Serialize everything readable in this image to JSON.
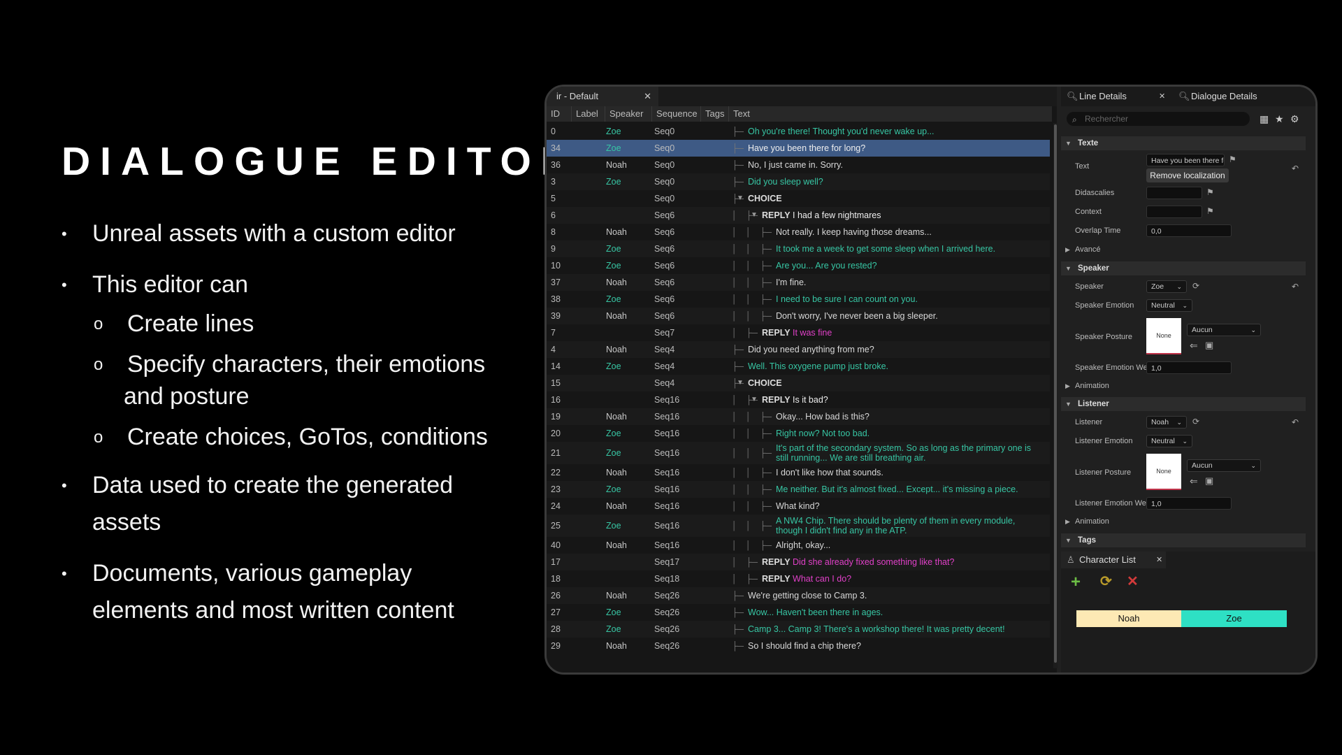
{
  "slide": {
    "title": "DIALOGUE EDITOR",
    "bullets": [
      {
        "text": "Unreal assets with a custom editor"
      },
      {
        "text": "This editor can"
      },
      {
        "text": "Data used to create the generated"
      },
      {
        "text": "assets"
      },
      {
        "text": "Documents, various gameplay"
      },
      {
        "text": "elements and most written content"
      }
    ],
    "sub_bullets": [
      {
        "text": "Create lines"
      },
      {
        "text": "Specify characters, their emotions"
      },
      {
        "text": "and posture"
      },
      {
        "text": "Create choices, GoTos, conditions"
      }
    ],
    "bullet_glyph": "•",
    "sub_bullet_glyph": "o"
  },
  "editor": {
    "tab_title": "ir - Default",
    "columns": [
      "ID",
      "Label",
      "Speaker",
      "Sequence",
      "Tags",
      "Text"
    ],
    "rows": [
      {
        "id": "0",
        "speaker": "Zoe",
        "seq": "Seq0",
        "depth": 0,
        "text": "Oh you're there! Thought you'd never wake up..."
      },
      {
        "id": "34",
        "speaker": "Zoe",
        "seq": "Seq0",
        "depth": 0,
        "text": "Have you been there for long?",
        "selected": true
      },
      {
        "id": "36",
        "speaker": "Noah",
        "seq": "Seq0",
        "depth": 0,
        "text": "No, I just came in. Sorry."
      },
      {
        "id": "3",
        "speaker": "Zoe",
        "seq": "Seq0",
        "depth": 0,
        "text": "Did you sleep well?"
      },
      {
        "id": "5",
        "speaker": "",
        "seq": "Seq0",
        "depth": 0,
        "kw": "CHOICE",
        "text": "",
        "expander": true
      },
      {
        "id": "6",
        "speaker": "",
        "seq": "Seq6",
        "depth": 1,
        "kw": "REPLY",
        "text": "I had a few nightmares",
        "tcolor": "white",
        "expander": true
      },
      {
        "id": "8",
        "speaker": "Noah",
        "seq": "Seq6",
        "depth": 2,
        "text": "Not really. I keep having those dreams..."
      },
      {
        "id": "9",
        "speaker": "Zoe",
        "seq": "Seq6",
        "depth": 2,
        "text": "It took me a week to get some sleep when I arrived here."
      },
      {
        "id": "10",
        "speaker": "Zoe",
        "seq": "Seq6",
        "depth": 2,
        "text": "Are you... Are you rested?"
      },
      {
        "id": "37",
        "speaker": "Noah",
        "seq": "Seq6",
        "depth": 2,
        "text": "I'm fine."
      },
      {
        "id": "38",
        "speaker": "Zoe",
        "seq": "Seq6",
        "depth": 2,
        "text": "I need to be sure I can count on you."
      },
      {
        "id": "39",
        "speaker": "Noah",
        "seq": "Seq6",
        "depth": 2,
        "text": "Don't worry, I've never been a big sleeper."
      },
      {
        "id": "7",
        "speaker": "",
        "seq": "Seq7",
        "depth": 1,
        "kw": "REPLY",
        "text": "It was fine",
        "tcolor": "mag"
      },
      {
        "id": "4",
        "speaker": "Noah",
        "seq": "Seq4",
        "depth": 0,
        "text": "Did you need anything from me?"
      },
      {
        "id": "14",
        "speaker": "Zoe",
        "seq": "Seq4",
        "depth": 0,
        "text": "Well. This oxygene pump just broke."
      },
      {
        "id": "15",
        "speaker": "",
        "seq": "Seq4",
        "depth": 0,
        "kw": "CHOICE",
        "text": "",
        "expander": true
      },
      {
        "id": "16",
        "speaker": "",
        "seq": "Seq16",
        "depth": 1,
        "kw": "REPLY",
        "text": "Is it bad?",
        "tcolor": "white",
        "expander": true
      },
      {
        "id": "19",
        "speaker": "Noah",
        "seq": "Seq16",
        "depth": 2,
        "text": "Okay... How bad is this?"
      },
      {
        "id": "20",
        "speaker": "Zoe",
        "seq": "Seq16",
        "depth": 2,
        "text": "Right now? Not too bad."
      },
      {
        "id": "21",
        "speaker": "Zoe",
        "seq": "Seq16",
        "depth": 2,
        "text": "It's part of the secondary system. So as long as the primary one is still running... We are still breathing air.",
        "tall": true
      },
      {
        "id": "22",
        "speaker": "Noah",
        "seq": "Seq16",
        "depth": 2,
        "text": "I don't like how that sounds."
      },
      {
        "id": "23",
        "speaker": "Zoe",
        "seq": "Seq16",
        "depth": 2,
        "text": "Me neither. But it's almost fixed... Except... it's missing a piece."
      },
      {
        "id": "24",
        "speaker": "Noah",
        "seq": "Seq16",
        "depth": 2,
        "text": "What kind?"
      },
      {
        "id": "25",
        "speaker": "Zoe",
        "seq": "Seq16",
        "depth": 2,
        "text": "A NW4 Chip. There should be plenty of them in every module, though I didn't find any in the ATP.",
        "tall": true
      },
      {
        "id": "40",
        "speaker": "Noah",
        "seq": "Seq16",
        "depth": 2,
        "text": "Alright, okay..."
      },
      {
        "id": "17",
        "speaker": "",
        "seq": "Seq17",
        "depth": 1,
        "kw": "REPLY",
        "text": "Did she already fixed something like that?",
        "tcolor": "mag"
      },
      {
        "id": "18",
        "speaker": "",
        "seq": "Seq18",
        "depth": 1,
        "kw": "REPLY",
        "text": "What can I do?",
        "tcolor": "mag"
      },
      {
        "id": "26",
        "speaker": "Noah",
        "seq": "Seq26",
        "depth": 0,
        "text": "We're getting close to Camp 3."
      },
      {
        "id": "27",
        "speaker": "Zoe",
        "seq": "Seq26",
        "depth": 0,
        "text": "Wow... Haven't been there in ages."
      },
      {
        "id": "28",
        "speaker": "Zoe",
        "seq": "Seq26",
        "depth": 0,
        "text": "Camp 3... Camp 3! There's a workshop there! It was pretty decent!"
      },
      {
        "id": "29",
        "speaker": "Noah",
        "seq": "Seq26",
        "depth": 0,
        "text": "So I should find a chip there?"
      }
    ]
  },
  "details": {
    "tab_line": "Line Details",
    "tab_dialogue": "Dialogue Details",
    "search_placeholder": "Rechercher",
    "sections": {
      "texte": "Texte",
      "speaker": "Speaker",
      "listener": "Listener",
      "tags": "Tags"
    },
    "subsections": {
      "avance": "Avancé",
      "animation1": "Animation",
      "animation2": "Animation"
    },
    "labels": {
      "text": "Text",
      "didascalies": "Didascalies",
      "context": "Context",
      "overlap": "Overlap Time",
      "speaker": "Speaker",
      "speaker_emotion": "Speaker Emotion",
      "speaker_posture": "Speaker Posture",
      "speaker_emotion_weight": "Speaker Emotion Wei...",
      "listener": "Listener",
      "listener_emotion": "Listener Emotion",
      "listener_posture": "Listener Posture",
      "listener_emotion_weight": "Listener Emotion Wei..."
    },
    "values": {
      "text": "Have you been there fo",
      "remove_localization": "Remove localization",
      "overlap": "0,0",
      "speaker": "Zoe",
      "speaker_emotion": "Neutral",
      "speaker_posture_thumb": "None",
      "speaker_posture_select": "Aucun",
      "speaker_emotion_weight": "1,0",
      "listener": "Noah",
      "listener_emotion": "Neutral",
      "listener_posture_thumb": "None",
      "listener_posture_select": "Aucun",
      "listener_emotion_weight": "1,0"
    }
  },
  "character_list": {
    "title": "Character List",
    "characters": [
      {
        "name": "Noah",
        "color": "#fde9b4"
      },
      {
        "name": "Zoe",
        "color": "#2ee0c4"
      }
    ],
    "tools": [
      "add-icon",
      "refresh-icon",
      "delete-icon"
    ]
  }
}
